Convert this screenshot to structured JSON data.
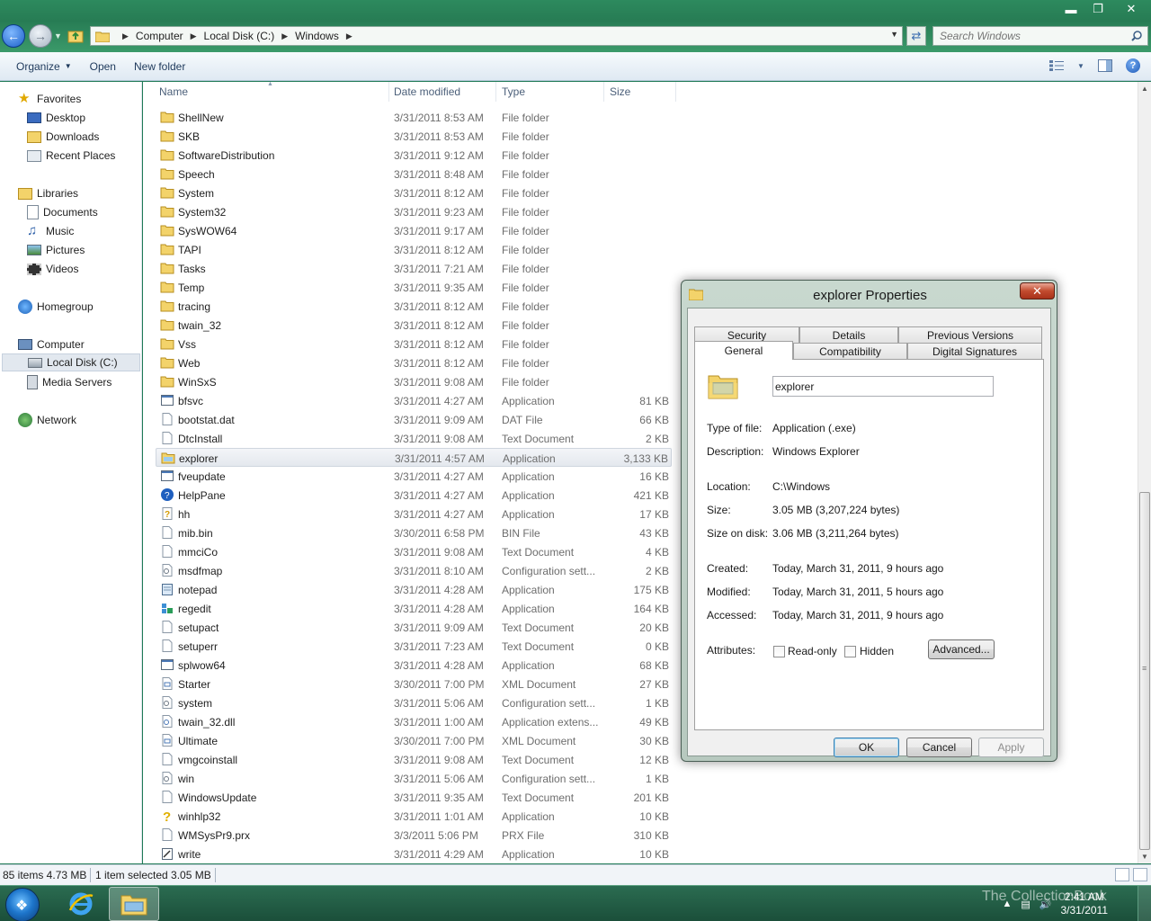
{
  "window": {
    "address": [
      "Computer",
      "Local Disk (C:)",
      "Windows"
    ],
    "search_placeholder": "Search Windows"
  },
  "commands": {
    "organize": "Organize",
    "open": "Open",
    "new_folder": "New folder"
  },
  "nav": {
    "favorites": "Favorites",
    "desktop": "Desktop",
    "downloads": "Downloads",
    "recent": "Recent Places",
    "libraries": "Libraries",
    "documents": "Documents",
    "music": "Music",
    "pictures": "Pictures",
    "videos": "Videos",
    "homegroup": "Homegroup",
    "computer": "Computer",
    "local_disk": "Local Disk (C:)",
    "media_servers": "Media Servers",
    "network": "Network"
  },
  "columns": {
    "name": "Name",
    "date": "Date modified",
    "type": "Type",
    "size": "Size"
  },
  "files": [
    {
      "name": "ShellNew",
      "date": "3/31/2011 8:53 AM",
      "type": "File folder",
      "size": "",
      "icon": "folder"
    },
    {
      "name": "SKB",
      "date": "3/31/2011 8:53 AM",
      "type": "File folder",
      "size": "",
      "icon": "folder"
    },
    {
      "name": "SoftwareDistribution",
      "date": "3/31/2011 9:12 AM",
      "type": "File folder",
      "size": "",
      "icon": "folder"
    },
    {
      "name": "Speech",
      "date": "3/31/2011 8:48 AM",
      "type": "File folder",
      "size": "",
      "icon": "folder"
    },
    {
      "name": "System",
      "date": "3/31/2011 8:12 AM",
      "type": "File folder",
      "size": "",
      "icon": "folder"
    },
    {
      "name": "System32",
      "date": "3/31/2011 9:23 AM",
      "type": "File folder",
      "size": "",
      "icon": "folder"
    },
    {
      "name": "SysWOW64",
      "date": "3/31/2011 9:17 AM",
      "type": "File folder",
      "size": "",
      "icon": "folder"
    },
    {
      "name": "TAPI",
      "date": "3/31/2011 8:12 AM",
      "type": "File folder",
      "size": "",
      "icon": "folder"
    },
    {
      "name": "Tasks",
      "date": "3/31/2011 7:21 AM",
      "type": "File folder",
      "size": "",
      "icon": "folder"
    },
    {
      "name": "Temp",
      "date": "3/31/2011 9:35 AM",
      "type": "File folder",
      "size": "",
      "icon": "folder"
    },
    {
      "name": "tracing",
      "date": "3/31/2011 8:12 AM",
      "type": "File folder",
      "size": "",
      "icon": "folder"
    },
    {
      "name": "twain_32",
      "date": "3/31/2011 8:12 AM",
      "type": "File folder",
      "size": "",
      "icon": "folder"
    },
    {
      "name": "Vss",
      "date": "3/31/2011 8:12 AM",
      "type": "File folder",
      "size": "",
      "icon": "folder"
    },
    {
      "name": "Web",
      "date": "3/31/2011 8:12 AM",
      "type": "File folder",
      "size": "",
      "icon": "folder"
    },
    {
      "name": "WinSxS",
      "date": "3/31/2011 9:08 AM",
      "type": "File folder",
      "size": "",
      "icon": "folder"
    },
    {
      "name": "bfsvc",
      "date": "3/31/2011 4:27 AM",
      "type": "Application",
      "size": "81 KB",
      "icon": "app"
    },
    {
      "name": "bootstat.dat",
      "date": "3/31/2011 9:09 AM",
      "type": "DAT File",
      "size": "66 KB",
      "icon": "doc"
    },
    {
      "name": "DtcInstall",
      "date": "3/31/2011 9:08 AM",
      "type": "Text Document",
      "size": "2 KB",
      "icon": "doc"
    },
    {
      "name": "explorer",
      "date": "3/31/2011 4:57 AM",
      "type": "Application",
      "size": "3,133 KB",
      "icon": "explorer",
      "selected": true
    },
    {
      "name": "fveupdate",
      "date": "3/31/2011 4:27 AM",
      "type": "Application",
      "size": "16 KB",
      "icon": "app"
    },
    {
      "name": "HelpPane",
      "date": "3/31/2011 4:27 AM",
      "type": "Application",
      "size": "421 KB",
      "icon": "help"
    },
    {
      "name": "hh",
      "date": "3/31/2011 4:27 AM",
      "type": "Application",
      "size": "17 KB",
      "icon": "hh"
    },
    {
      "name": "mib.bin",
      "date": "3/30/2011 6:58 PM",
      "type": "BIN File",
      "size": "43 KB",
      "icon": "doc"
    },
    {
      "name": "mmciCo",
      "date": "3/31/2011 9:08 AM",
      "type": "Text Document",
      "size": "4 KB",
      "icon": "doc"
    },
    {
      "name": "msdfmap",
      "date": "3/31/2011 8:10 AM",
      "type": "Configuration sett...",
      "size": "2 KB",
      "icon": "config"
    },
    {
      "name": "notepad",
      "date": "3/31/2011 4:28 AM",
      "type": "Application",
      "size": "175 KB",
      "icon": "notepad"
    },
    {
      "name": "regedit",
      "date": "3/31/2011 4:28 AM",
      "type": "Application",
      "size": "164 KB",
      "icon": "regedit"
    },
    {
      "name": "setupact",
      "date": "3/31/2011 9:09 AM",
      "type": "Text Document",
      "size": "20 KB",
      "icon": "doc"
    },
    {
      "name": "setuperr",
      "date": "3/31/2011 7:23 AM",
      "type": "Text Document",
      "size": "0 KB",
      "icon": "doc"
    },
    {
      "name": "splwow64",
      "date": "3/31/2011 4:28 AM",
      "type": "Application",
      "size": "68 KB",
      "icon": "app"
    },
    {
      "name": "Starter",
      "date": "3/30/2011 7:00 PM",
      "type": "XML Document",
      "size": "27 KB",
      "icon": "xml"
    },
    {
      "name": "system",
      "date": "3/31/2011 5:06 AM",
      "type": "Configuration sett...",
      "size": "1 KB",
      "icon": "config"
    },
    {
      "name": "twain_32.dll",
      "date": "3/31/2011 1:00 AM",
      "type": "Application extens...",
      "size": "49 KB",
      "icon": "dll"
    },
    {
      "name": "Ultimate",
      "date": "3/30/2011 7:00 PM",
      "type": "XML Document",
      "size": "30 KB",
      "icon": "xml"
    },
    {
      "name": "vmgcoinstall",
      "date": "3/31/2011 9:08 AM",
      "type": "Text Document",
      "size": "12 KB",
      "icon": "doc"
    },
    {
      "name": "win",
      "date": "3/31/2011 5:06 AM",
      "type": "Configuration sett...",
      "size": "1 KB",
      "icon": "config"
    },
    {
      "name": "WindowsUpdate",
      "date": "3/31/2011 9:35 AM",
      "type": "Text Document",
      "size": "201 KB",
      "icon": "doc"
    },
    {
      "name": "winhlp32",
      "date": "3/31/2011 1:01 AM",
      "type": "Application",
      "size": "10 KB",
      "icon": "winhlp"
    },
    {
      "name": "WMSysPr9.prx",
      "date": "3/3/2011 5:06 PM",
      "type": "PRX File",
      "size": "310 KB",
      "icon": "doc"
    },
    {
      "name": "write",
      "date": "3/31/2011 4:29 AM",
      "type": "Application",
      "size": "10 KB",
      "icon": "write"
    }
  ],
  "status": {
    "items": "85 items  4.73 MB",
    "selected": "1 item selected  3.05 MB"
  },
  "taskbar": {
    "time": "2:41 AM",
    "date": "3/31/2011",
    "watermark": "The CollectionBook"
  },
  "dialog": {
    "title": "explorer Properties",
    "tabs": {
      "security": "Security",
      "details": "Details",
      "previous_versions": "Previous Versions",
      "general": "General",
      "compatibility": "Compatibility",
      "digital_signatures": "Digital Signatures"
    },
    "name": "explorer",
    "type_label": "Type of file:",
    "type_value": "Application (.exe)",
    "desc_label": "Description:",
    "desc_value": "Windows Explorer",
    "location_label": "Location:",
    "location_value": "C:\\Windows",
    "size_label": "Size:",
    "size_value": "3.05 MB (3,207,224 bytes)",
    "disk_label": "Size on disk:",
    "disk_value": "3.06 MB (3,211,264 bytes)",
    "created_label": "Created:",
    "created_value": "Today, March 31, 2011, 9 hours ago",
    "modified_label": "Modified:",
    "modified_value": "Today, March 31, 2011, 5 hours ago",
    "accessed_label": "Accessed:",
    "accessed_value": "Today, March 31, 2011, 9 hours ago",
    "attributes_label": "Attributes:",
    "readonly_label": "Read-only",
    "hidden_label": "Hidden",
    "advanced_label": "Advanced...",
    "ok_label": "OK",
    "cancel_label": "Cancel",
    "apply_label": "Apply"
  }
}
